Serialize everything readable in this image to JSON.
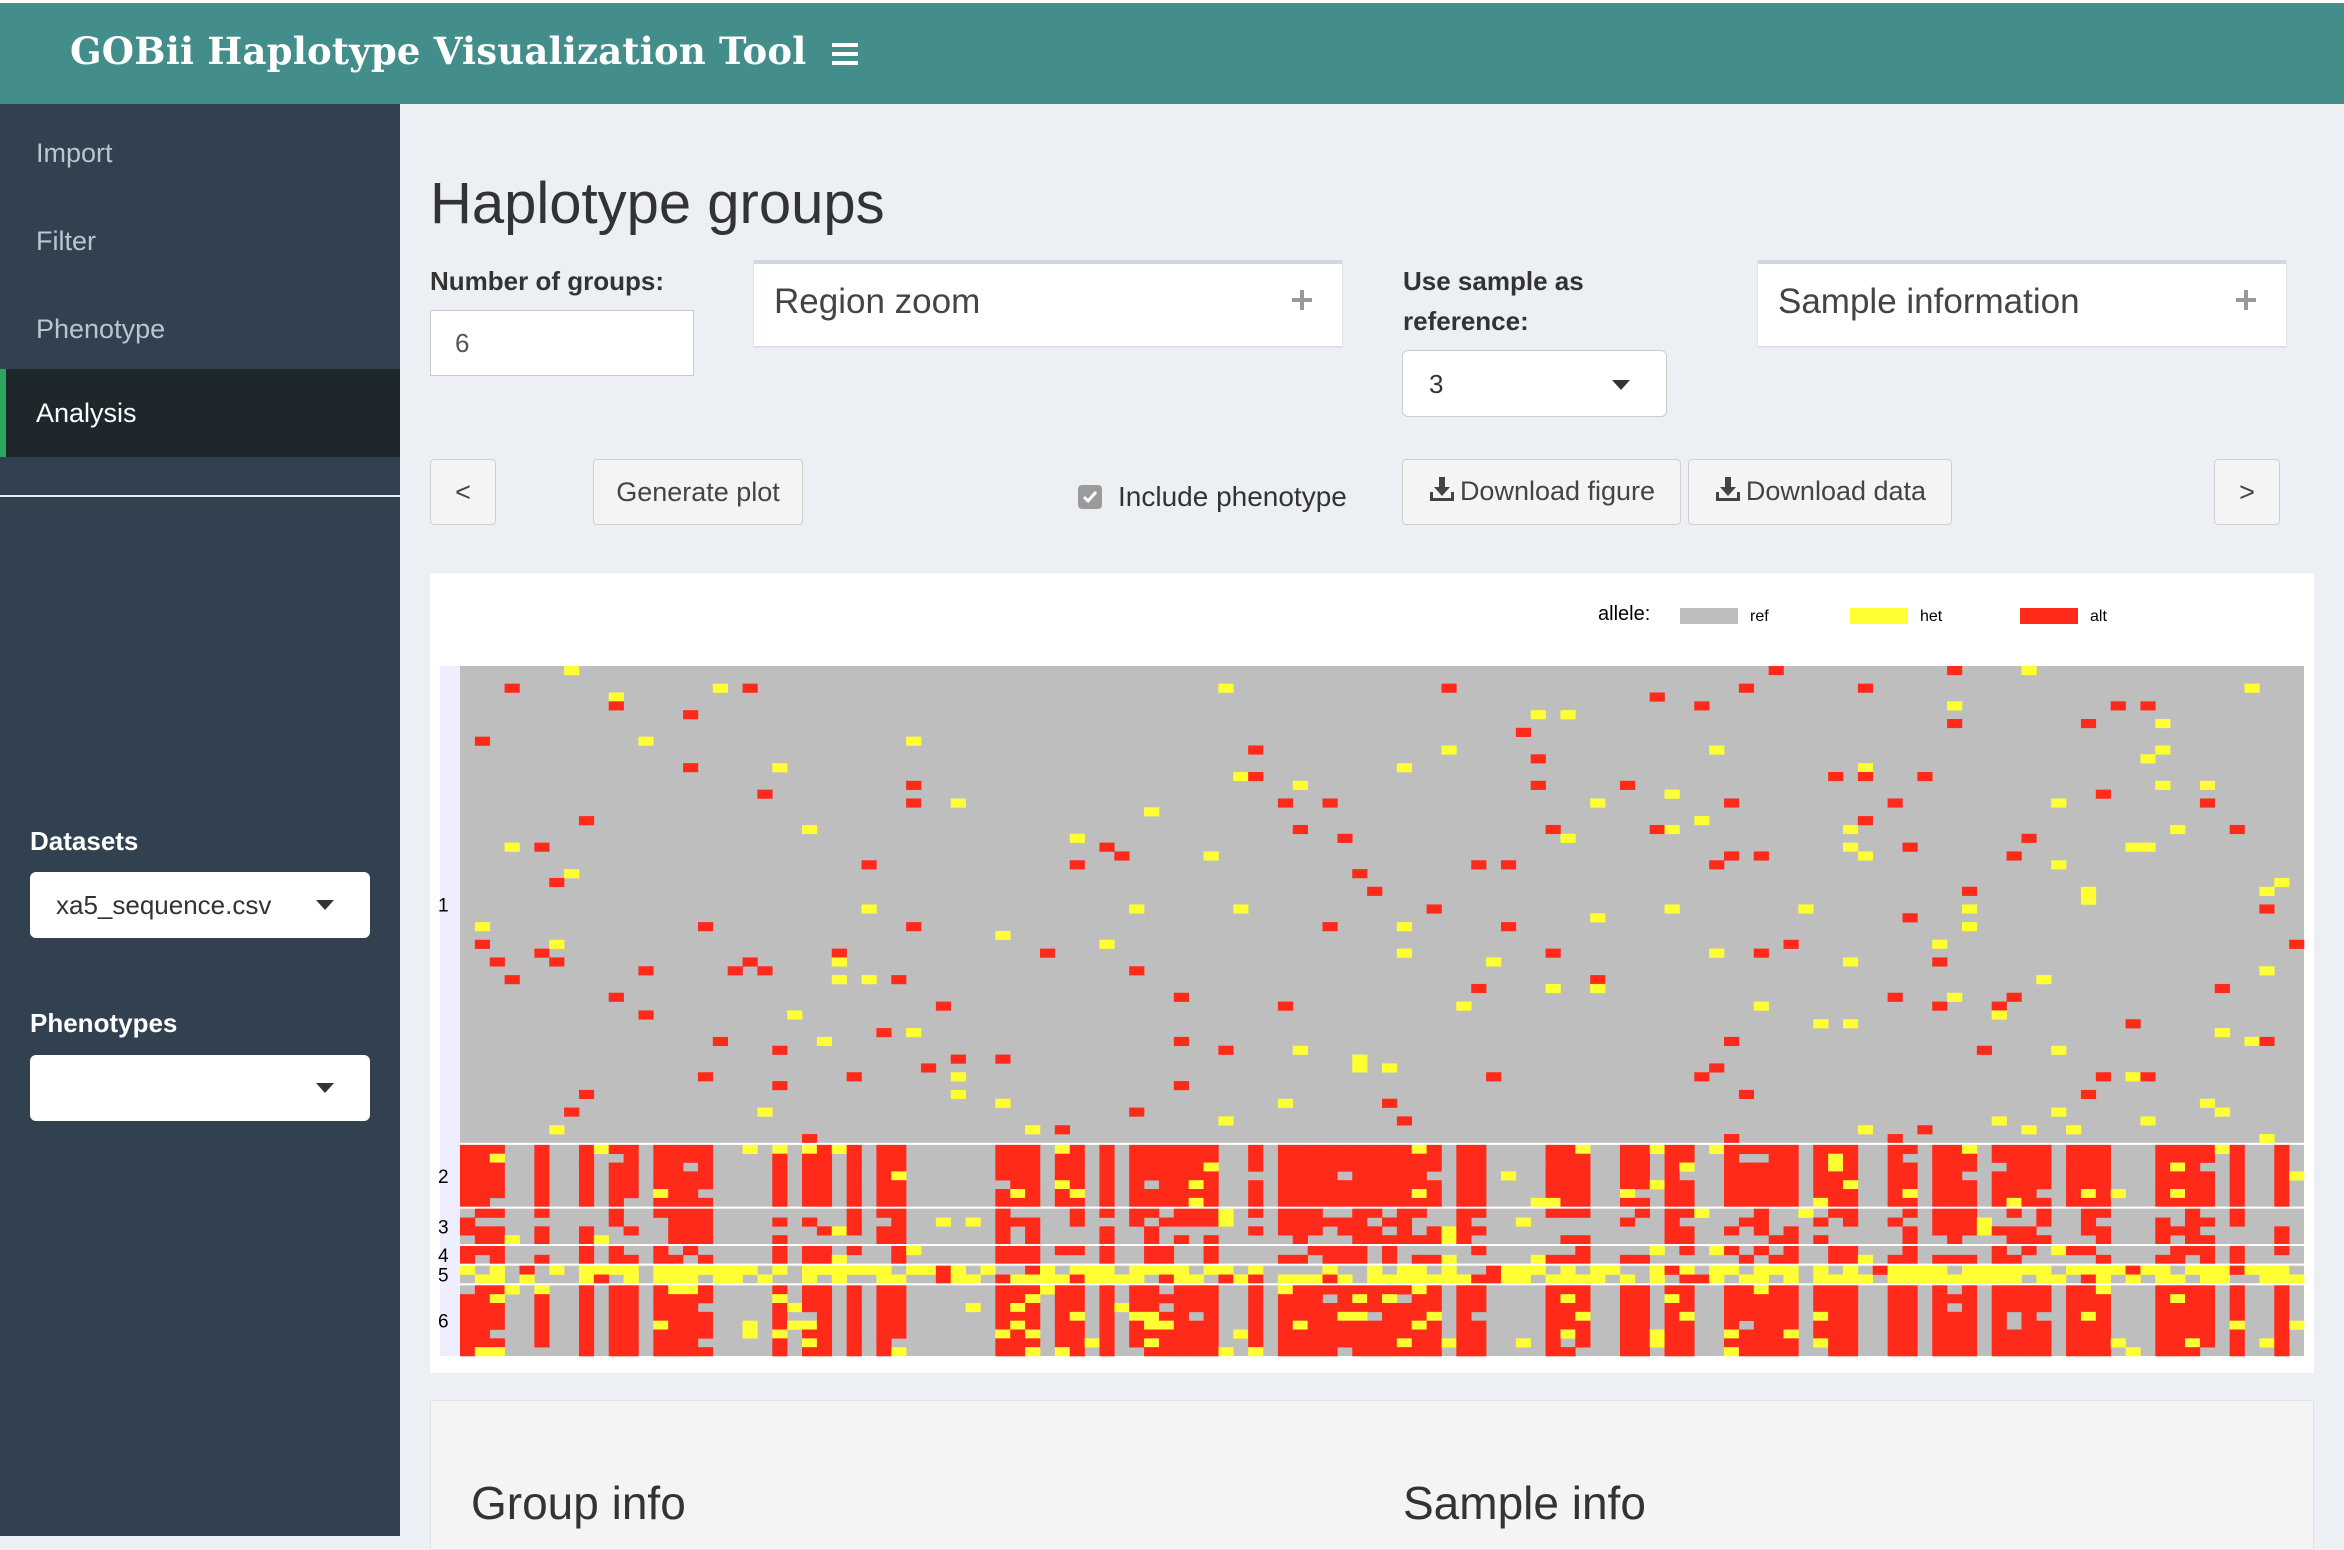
{
  "app": {
    "title": "GOBii Haplotype Visualization Tool"
  },
  "sidebar": {
    "items": [
      {
        "label": "Import",
        "active": false
      },
      {
        "label": "Filter",
        "active": false
      },
      {
        "label": "Phenotype",
        "active": false
      },
      {
        "label": "Analysis",
        "active": true
      }
    ],
    "datasets": {
      "label": "Datasets",
      "value": "xa5_sequence.csv"
    },
    "phenotypes": {
      "label": "Phenotypes",
      "value": ""
    }
  },
  "main": {
    "title": "Haplotype groups",
    "num_groups": {
      "label": "Number of groups:",
      "value": "6"
    },
    "region_zoom": {
      "title": "Region zoom"
    },
    "reference": {
      "label_line1": "Use sample as",
      "label_line2": "reference:",
      "value": "3"
    },
    "sample_information": {
      "title": "Sample information"
    },
    "buttons": {
      "prev": "<",
      "generate": "Generate plot",
      "download_figure": "Download figure",
      "download_data": "Download data",
      "next": ">"
    },
    "include_phenotype": {
      "label": "Include phenotype",
      "checked": true
    }
  },
  "chart_data": {
    "type": "heatmap",
    "title": "",
    "legend": {
      "title": "allele:",
      "placement": "top-right",
      "entries": [
        {
          "label": "ref",
          "color": "#bebebe"
        },
        {
          "label": "het",
          "color": "#ffff33"
        },
        {
          "label": "alt",
          "color": "#ff2a1a"
        }
      ]
    },
    "groups": [
      "1",
      "2",
      "3",
      "4",
      "5",
      "6"
    ],
    "group_rows": [
      54,
      7,
      4,
      2,
      2,
      8
    ],
    "n_columns": 124,
    "group_dominant_allele": [
      "ref",
      "alt",
      "ref",
      "ref",
      "het",
      "alt"
    ]
  },
  "colors": {
    "header": "#438d8a",
    "sidebar": "#324150",
    "active_accent": "#2aa65e",
    "ref": "#bebebe",
    "het": "#ffff33",
    "alt": "#ff2a1a"
  },
  "bottom": {
    "group_info": "Group info",
    "sample_info": "Sample info"
  }
}
